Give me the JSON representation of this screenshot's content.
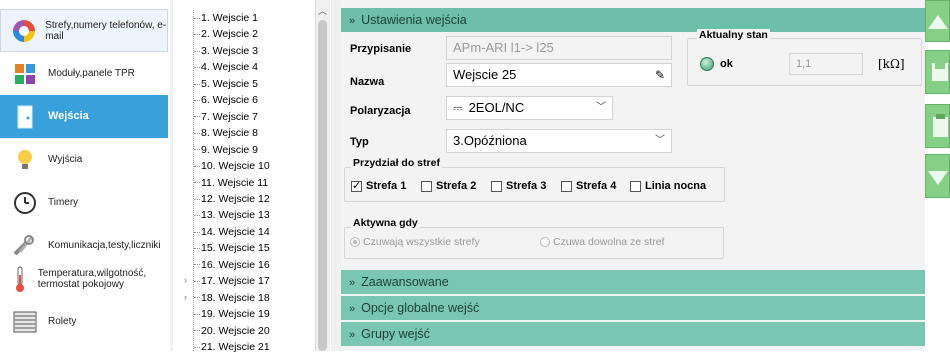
{
  "sidebar": {
    "items": [
      {
        "label": "Strefy,numery telefonów, e-mail",
        "icon": "colored-circle-icon"
      },
      {
        "label": "Moduły,panele TPR",
        "icon": "modules-icon"
      },
      {
        "label": "Wejścia",
        "icon": "door-icon"
      },
      {
        "label": "Wyjścia",
        "icon": "lightbulb-icon"
      },
      {
        "label": "Timery",
        "icon": "clock-icon"
      },
      {
        "label": "Komunikacja,testy,liczniki",
        "icon": "tools-icon"
      },
      {
        "label": "Temperatura,wilgotność, termostat pokojowy",
        "icon": "thermometer-icon"
      },
      {
        "label": "Rolety",
        "icon": "blinds-icon"
      }
    ],
    "active_index": 2
  },
  "tree": {
    "items": [
      "1. Wejscie 1",
      "2. Wejscie 2",
      "3. Wejscie 3",
      "4. Wejscie 4",
      "5. Wejscie 5",
      "6. Wejscie 6",
      "7. Wejscie 7",
      "8. Wejscie 8",
      "9. Wejscie 9",
      "10. Wejscie 10",
      "11. Wejscie 11",
      "12. Wejscie 12",
      "13. Wejscie 13",
      "14. Wejscie 14",
      "15. Wejscie 15",
      "16. Wejscie 16",
      "17. Wejscie 17",
      "18. Wejscie 18",
      "19. Wejscie 19",
      "20. Wejscie 20",
      "21. Wejscie 21"
    ],
    "expandable_indexes": [
      16,
      17
    ]
  },
  "sections": {
    "settings": "Ustawienia wejścia",
    "advanced": "Zaawansowane",
    "global": "Opcje globalne wejść",
    "groups": "Grupy wejść"
  },
  "form": {
    "przypisanie_label": "Przypisanie",
    "przypisanie_value": "APm-ARI l1-> l25",
    "nazwa_label": "Nazwa",
    "nazwa_value": "Wejscie 25",
    "polaryzacja_label": "Polaryzacja",
    "polaryzacja_value": "2EOL/NC",
    "typ_label": "Typ",
    "typ_value": "3.Opóźniona"
  },
  "state": {
    "title": "Aktualny stan",
    "status": "ok",
    "value": "1,1",
    "unit": "[kΩ]"
  },
  "zones": {
    "title": "Przydział do stref",
    "items": [
      {
        "label": "Strefa 1",
        "checked": true
      },
      {
        "label": "Strefa 2",
        "checked": false
      },
      {
        "label": "Strefa 3",
        "checked": false
      },
      {
        "label": "Strefa 4",
        "checked": false
      },
      {
        "label": "Linia nocna",
        "checked": false
      }
    ]
  },
  "active_when": {
    "title": "Aktywna gdy",
    "options": [
      {
        "label": "Czuwają wszystkie strefy",
        "selected": true
      },
      {
        "label": "Czuwa dowolna ze stref",
        "selected": false
      }
    ]
  },
  "colors": {
    "accent": "#3aa0dc",
    "section": "#79c6b2",
    "rail_button": "#86cf86"
  }
}
